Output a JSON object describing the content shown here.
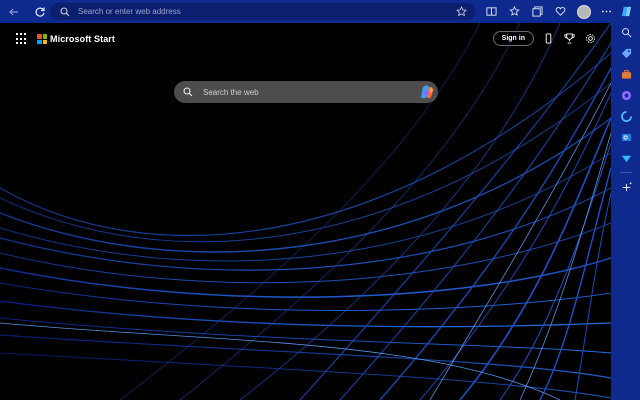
{
  "browser": {
    "address_placeholder": "Search or enter web address",
    "accent_color": "#0f2a8f"
  },
  "header": {
    "brand_name": "Microsoft Start",
    "signin_label": "Sign in"
  },
  "search": {
    "placeholder": "Search the web"
  },
  "sidebar": {
    "items": [
      "copilot-icon",
      "search-icon",
      "tag-icon",
      "briefcase-icon",
      "games-icon",
      "outlook-icon",
      "send-icon",
      "add-icon"
    ]
  }
}
